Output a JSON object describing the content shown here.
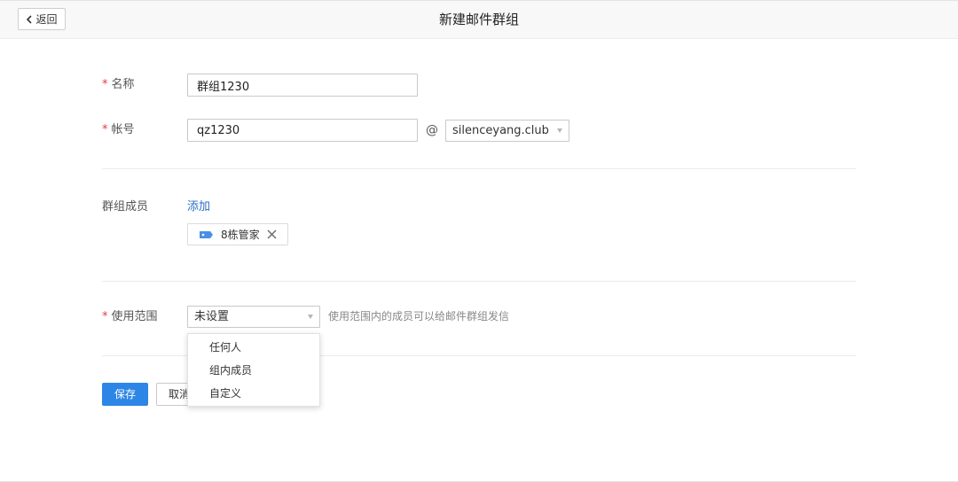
{
  "header": {
    "back_label": "返回",
    "title": "新建邮件群组"
  },
  "form": {
    "required_mark": "*",
    "name": {
      "label": "名称",
      "value": "群组1230"
    },
    "account": {
      "label": "帐号",
      "value": "qz1230",
      "at": "@",
      "domain": "silenceyang.club"
    },
    "members": {
      "label": "群组成员",
      "add_label": "添加",
      "items": [
        {
          "name": "8栋管家",
          "icon": "tag-icon",
          "close_icon": "close-icon"
        }
      ]
    },
    "scope": {
      "label": "使用范围",
      "selected": "未设置",
      "hint": "使用范围内的成员可以给邮件群组发信",
      "options": [
        "任何人",
        "组内成员",
        "自定义"
      ]
    }
  },
  "actions": {
    "save_label": "保存",
    "cancel_label": "取消"
  },
  "colors": {
    "accent": "#2d86e6",
    "link": "#2a6fc2",
    "required": "#e4393c",
    "tag_icon": "#4a90e2"
  }
}
